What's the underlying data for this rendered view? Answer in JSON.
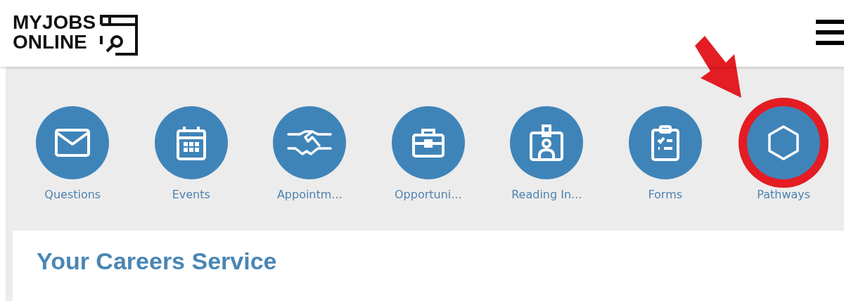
{
  "header": {
    "logo_lines": [
      "MYJOBS",
      "ONLINE"
    ]
  },
  "shortcuts": [
    {
      "label": "Questions",
      "kind": "envelope",
      "highlighted": false
    },
    {
      "label": "Events",
      "kind": "calendar",
      "highlighted": false
    },
    {
      "label": "Appointm...",
      "kind": "handshake",
      "highlighted": false
    },
    {
      "label": "Opportuni...",
      "kind": "briefcase",
      "highlighted": false
    },
    {
      "label": "Reading In...",
      "kind": "badge",
      "highlighted": false
    },
    {
      "label": "Forms",
      "kind": "clipboard",
      "highlighted": false
    },
    {
      "label": "Pathways",
      "kind": "hexagon",
      "highlighted": true
    }
  ],
  "card": {
    "title": "Your Careers Service"
  }
}
